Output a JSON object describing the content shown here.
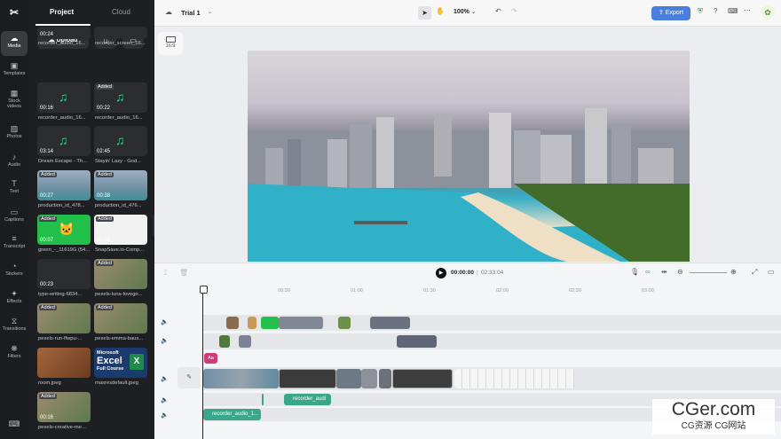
{
  "rail": {
    "items": [
      {
        "label": "Media",
        "icon": "media-icon",
        "glyph": "☁"
      },
      {
        "label": "Templates",
        "icon": "templates-icon",
        "glyph": "▣"
      },
      {
        "label": "Stock\nvideos",
        "icon": "stock-videos-icon",
        "glyph": "▦"
      },
      {
        "label": "Photos",
        "icon": "photos-icon",
        "glyph": "▨"
      },
      {
        "label": "Audio",
        "icon": "audio-icon",
        "glyph": "♪"
      },
      {
        "label": "Text",
        "icon": "text-icon",
        "glyph": "T"
      },
      {
        "label": "Captions",
        "icon": "captions-icon",
        "glyph": "▭"
      },
      {
        "label": "Transcript",
        "icon": "transcript-icon",
        "glyph": "≡"
      },
      {
        "label": "Stickers",
        "icon": "stickers-icon",
        "glyph": "◔"
      },
      {
        "label": "Effects",
        "icon": "effects-icon",
        "glyph": "✦"
      },
      {
        "label": "Transitions",
        "icon": "transitions-icon",
        "glyph": "⧖"
      },
      {
        "label": "Filters",
        "icon": "filters-icon",
        "glyph": "❋"
      }
    ]
  },
  "panel": {
    "tab_project": "Project",
    "tab_cloud": "Cloud",
    "upload": "Upload",
    "assets": [
      {
        "name": "recorder_audio_16...",
        "dur": "00:24",
        "added": "",
        "kind": "dark"
      },
      {
        "name": "recorder_screen_16...",
        "dur": "",
        "added": "",
        "kind": "dark"
      },
      {
        "name": "recorder_audio_16...",
        "dur": "00:16",
        "added": "",
        "kind": "audio"
      },
      {
        "name": "recorder_audio_16...",
        "dur": "00:22",
        "added": "Added",
        "kind": "audio"
      },
      {
        "name": "Dream Escape - Th...",
        "dur": "03:14",
        "added": "",
        "kind": "audio"
      },
      {
        "name": "Stayin' Lazy - God...",
        "dur": "02:45",
        "added": "",
        "kind": "audio"
      },
      {
        "name": "production_id_478...",
        "dur": "00:27",
        "added": "Added",
        "kind": "city"
      },
      {
        "name": "production_id_476...",
        "dur": "00:38",
        "added": "Added",
        "kind": "city"
      },
      {
        "name": "green_-_11619G (54...",
        "dur": "00:07",
        "added": "Added",
        "kind": "green"
      },
      {
        "name": "SnapSave.io-Comp...",
        "dur": "00:58",
        "added": "Added",
        "kind": "white"
      },
      {
        "name": "type-writing-6834...",
        "dur": "00:23",
        "added": "",
        "kind": "dark"
      },
      {
        "name": "pexels-luna-lovego...",
        "dur": "",
        "added": "Added",
        "kind": "photo"
      },
      {
        "name": "pexels-run-ffwpu-...",
        "dur": "",
        "added": "Added",
        "kind": "photo"
      },
      {
        "name": "pexels-emma-baus...",
        "dur": "",
        "added": "Added",
        "kind": "photo"
      },
      {
        "name": "room.jpeg",
        "dur": "",
        "added": "",
        "kind": "room"
      },
      {
        "name": "masresdefault.jpeg",
        "dur": "",
        "added": "",
        "kind": "excel"
      },
      {
        "name": "pexels-creative-me...",
        "dur": "00:16",
        "added": "Added",
        "kind": "photo"
      }
    ],
    "excel_line1": "Microsoft",
    "excel_line2": "Excel",
    "excel_line3": "Full Course"
  },
  "topbar": {
    "title": "Trial 1",
    "zoom": "100%",
    "export": "Export",
    "accent": "#4a7fe0"
  },
  "canvas": {
    "ratio": "16:9"
  },
  "playback": {
    "current": "00:00:00",
    "total": "02:33:04"
  },
  "timeline": {
    "ticks": [
      "00:30",
      "01:00",
      "01:30",
      "02:00",
      "02:30",
      "03:00"
    ],
    "audio1": "recorder_audi",
    "audio2": "recorder_audio_1..."
  },
  "watermark": {
    "line1": "CGer.com",
    "line2": "CG资源 CG网站"
  }
}
